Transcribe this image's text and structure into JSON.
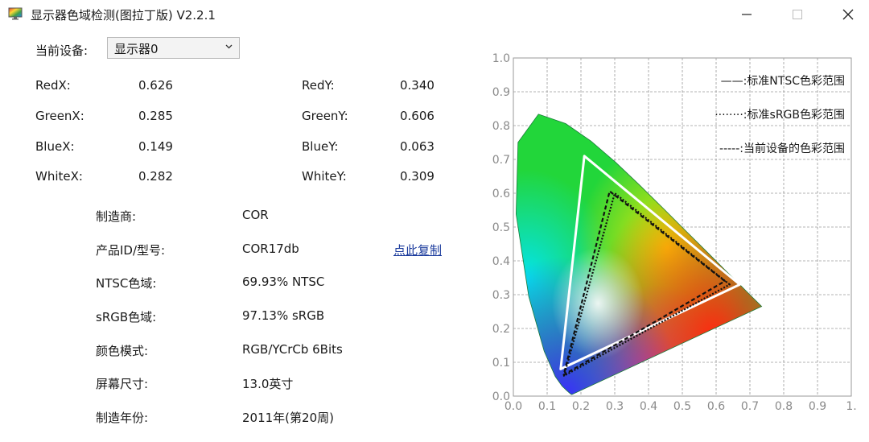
{
  "window": {
    "title": "显示器色域检测(图拉丁版) V2.2.1"
  },
  "device": {
    "label": "当前设备:",
    "selected": "显示器0"
  },
  "coordinates": [
    {
      "label": "RedX:",
      "value": "0.626"
    },
    {
      "label": "RedY:",
      "value": "0.340"
    },
    {
      "label": "GreenX:",
      "value": "0.285"
    },
    {
      "label": "GreenY:",
      "value": "0.606"
    },
    {
      "label": "BlueX:",
      "value": "0.149"
    },
    {
      "label": "BlueY:",
      "value": "0.063"
    },
    {
      "label": "WhiteX:",
      "value": "0.282"
    },
    {
      "label": "WhiteY:",
      "value": "0.309"
    }
  ],
  "info": [
    {
      "label": "制造商:",
      "value": "COR"
    },
    {
      "label": "产品ID/型号:",
      "value": "COR17db"
    },
    {
      "label": "NTSC色域:",
      "value": "69.93% NTSC"
    },
    {
      "label": "sRGB色域:",
      "value": "97.13% sRGB"
    },
    {
      "label": "颜色模式:",
      "value": "RGB/YCrCb 6Bits"
    },
    {
      "label": "屏幕尺寸:",
      "value": "13.0英寸"
    },
    {
      "label": "制造年份:",
      "value": "2011年(第20周)"
    }
  ],
  "copy_link": "点此复制",
  "chart_data": {
    "type": "scatter",
    "title": "",
    "xlabel": "",
    "ylabel": "",
    "xlim": [
      0,
      1
    ],
    "ylim": [
      0,
      1
    ],
    "x_ticks": [
      "0.0",
      "0.1",
      "0.2",
      "0.3",
      "0.4",
      "0.5",
      "0.6",
      "0.7",
      "0.8",
      "0.9",
      "1."
    ],
    "y_ticks": [
      "0.0",
      "0.1",
      "0.2",
      "0.3",
      "0.4",
      "0.5",
      "0.6",
      "0.7",
      "0.8",
      "0.9",
      "1.0"
    ],
    "grid": true,
    "legend_position": "top-right",
    "series": [
      {
        "name": "——:标准NTSC色彩范围",
        "style": "solid",
        "color": "#ffffff",
        "points": [
          [
            0.67,
            0.33
          ],
          [
            0.21,
            0.71
          ],
          [
            0.14,
            0.08
          ]
        ]
      },
      {
        "name": "········:标准sRGB色彩范围",
        "style": "dotted",
        "color": "#111111",
        "points": [
          [
            0.64,
            0.33
          ],
          [
            0.3,
            0.6
          ],
          [
            0.15,
            0.06
          ]
        ]
      },
      {
        "name": "-----:当前设备的色彩范围",
        "style": "dashed",
        "color": "#111111",
        "points": [
          [
            0.626,
            0.34
          ],
          [
            0.285,
            0.606
          ],
          [
            0.149,
            0.063
          ]
        ]
      }
    ],
    "locus": [
      [
        0.1741,
        0.005
      ],
      [
        0.1738,
        0.0049
      ],
      [
        0.1736,
        0.0049
      ],
      [
        0.1733,
        0.0048
      ],
      [
        0.1726,
        0.0048
      ],
      [
        0.1714,
        0.0051
      ],
      [
        0.1689,
        0.0069
      ],
      [
        0.1644,
        0.0109
      ],
      [
        0.1566,
        0.0177
      ],
      [
        0.144,
        0.0297
      ],
      [
        0.1241,
        0.0578
      ],
      [
        0.0913,
        0.1327
      ],
      [
        0.0454,
        0.295
      ],
      [
        0.0082,
        0.5384
      ],
      [
        0.0139,
        0.7502
      ],
      [
        0.0743,
        0.8338
      ],
      [
        0.1547,
        0.8059
      ],
      [
        0.2296,
        0.7543
      ],
      [
        0.3016,
        0.6923
      ],
      [
        0.3731,
        0.6245
      ],
      [
        0.4441,
        0.5547
      ],
      [
        0.5125,
        0.4866
      ],
      [
        0.5752,
        0.4242
      ],
      [
        0.627,
        0.3725
      ],
      [
        0.6658,
        0.334
      ],
      [
        0.6915,
        0.3083
      ],
      [
        0.7079,
        0.292
      ],
      [
        0.719,
        0.2809
      ],
      [
        0.726,
        0.274
      ],
      [
        0.7347,
        0.2653
      ]
    ]
  }
}
